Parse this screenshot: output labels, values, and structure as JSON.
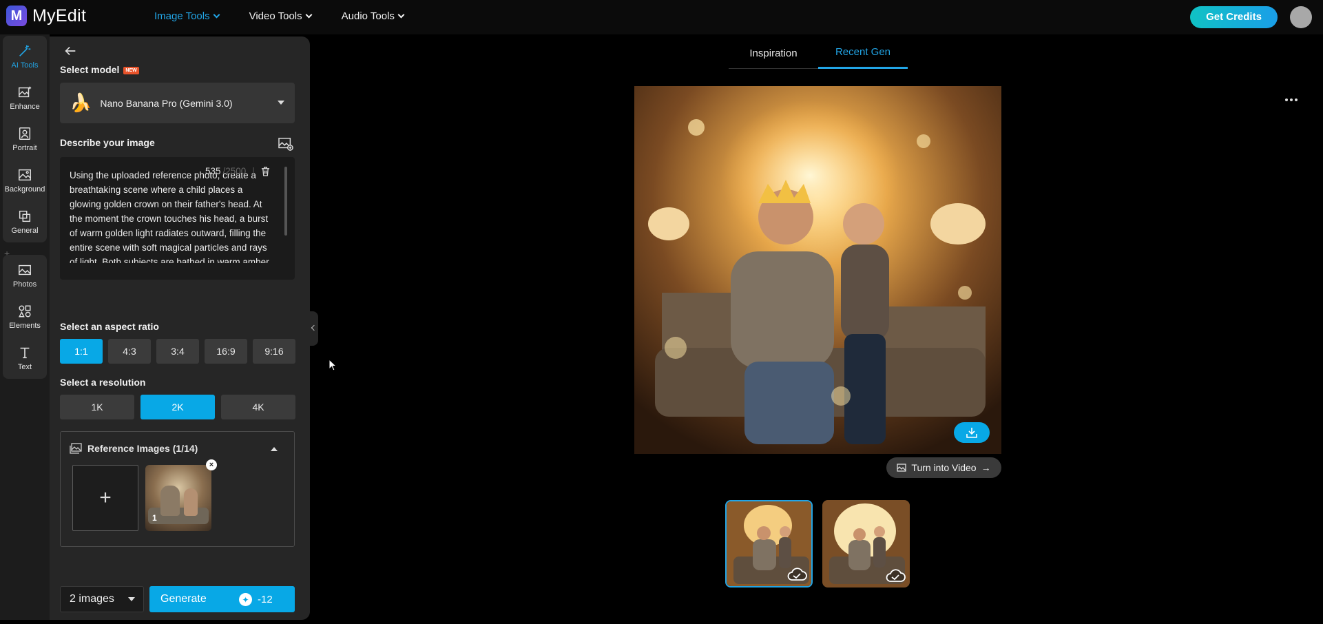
{
  "app": {
    "logo_letter": "M",
    "logo_text": "MyEdit"
  },
  "nav": [
    {
      "label": "Image Tools",
      "active": true
    },
    {
      "label": "Video Tools",
      "active": false
    },
    {
      "label": "Audio Tools",
      "active": false
    }
  ],
  "header": {
    "credits_label": "Get Credits"
  },
  "rail": {
    "top": [
      {
        "label": "AI Tools",
        "icon": "magic-wand-icon",
        "active": true
      },
      {
        "label": "Enhance",
        "icon": "enhance-icon"
      },
      {
        "label": "Portrait",
        "icon": "portrait-icon"
      },
      {
        "label": "Background",
        "icon": "background-icon"
      },
      {
        "label": "General",
        "icon": "general-icon"
      }
    ],
    "bottom": [
      {
        "label": "Photos",
        "icon": "photos-icon"
      },
      {
        "label": "Elements",
        "icon": "elements-icon"
      },
      {
        "label": "Text",
        "icon": "text-icon"
      }
    ]
  },
  "panel": {
    "model_label": "Select model",
    "new_badge": "NEW",
    "model_name": "Nano Banana Pro (Gemini 3.0)",
    "describe_label": "Describe your image",
    "prompt": "Using the uploaded reference photo, create a breathtaking scene where a child places a glowing golden crown on their father's head. At the moment the crown touches his head, a burst of warm golden light radiates outward, filling the entire scene with soft magical particles and rays of light. Both subjects are bathed in warm amber and gold. Background",
    "char_count": "535",
    "char_max": "/2500",
    "char_sep": "|",
    "aspect_label": "Select an aspect ratio",
    "aspect_ratios": [
      {
        "label": "1:1",
        "active": true
      },
      {
        "label": "4:3",
        "active": false
      },
      {
        "label": "3:4",
        "active": false
      },
      {
        "label": "16:9",
        "active": false
      },
      {
        "label": "9:16",
        "active": false
      }
    ],
    "resolution_label": "Select a resolution",
    "resolutions": [
      {
        "label": "1K",
        "active": false
      },
      {
        "label": "2K",
        "active": true
      },
      {
        "label": "4K",
        "active": false
      }
    ],
    "ref_label": "Reference Images (1/14)",
    "ref_add": "+",
    "ref_thumb_number": "1",
    "ref_remove": "×",
    "image_count": "2 images",
    "generate_label": "Generate",
    "generate_cost": "-12"
  },
  "main": {
    "tabs": [
      {
        "label": "Inspiration",
        "active": false
      },
      {
        "label": "Recent Gen",
        "active": true
      }
    ],
    "video_label": "Turn into Video",
    "video_arrow": "→"
  },
  "colors": {
    "accent": "#08a8e6",
    "credits_gradient_start": "#10c2c4",
    "credits_gradient_end": "#1a9ee8",
    "panel_bg": "#262626",
    "rail_bg": "#1c1c1c"
  }
}
